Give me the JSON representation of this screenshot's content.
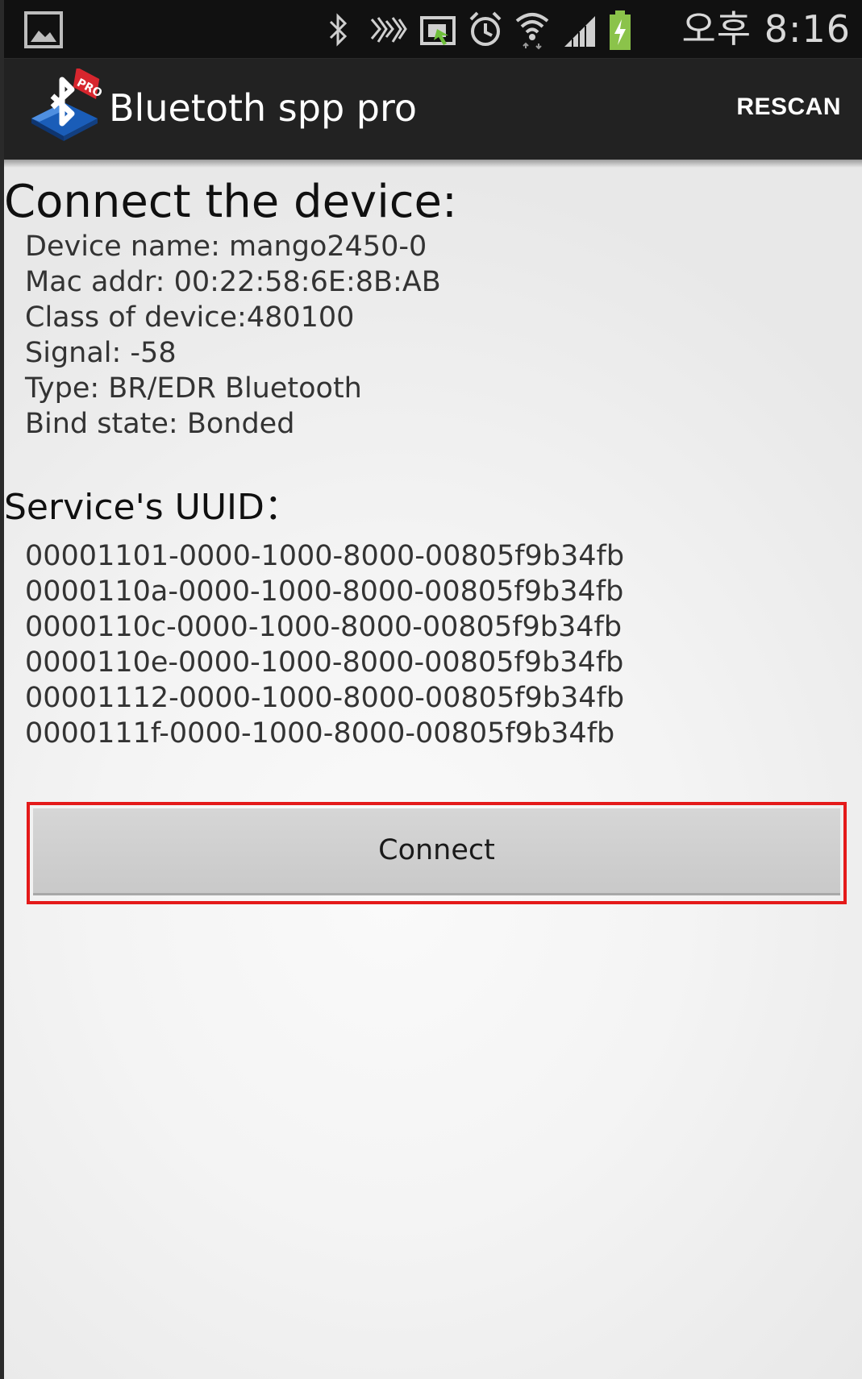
{
  "status_bar": {
    "time": "오후 8:16",
    "icons": [
      "gallery-icon",
      "bluetooth-icon",
      "nfc-icon",
      "screen-mirror-icon",
      "alarm-icon",
      "wifi-icon",
      "signal-icon",
      "battery-charging-icon"
    ]
  },
  "action_bar": {
    "app_title": "Bluetoth spp pro",
    "logo_badge": "PRO",
    "rescan_label": "RESCAN"
  },
  "device": {
    "heading": "Connect the device:",
    "lines": [
      "Device name: mango2450-0",
      "Mac addr: 00:22:58:6E:8B:AB",
      "Class of device:480100",
      "Signal: -58",
      "Type: BR/EDR Bluetooth",
      "Bind state: Bonded"
    ]
  },
  "services": {
    "heading": "Service's UUID：",
    "uuids": [
      "00001101-0000-1000-8000-00805f9b34fb",
      "0000110a-0000-1000-8000-00805f9b34fb",
      "0000110c-0000-1000-8000-00805f9b34fb",
      "0000110e-0000-1000-8000-00805f9b34fb",
      "00001112-0000-1000-8000-00805f9b34fb",
      "0000111f-0000-1000-8000-00805f9b34fb"
    ]
  },
  "connect_button": {
    "label": "Connect",
    "highlight_color": "#e41a1a"
  },
  "colors": {
    "status_bar_bg": "#111111",
    "action_bar_bg": "#222222",
    "battery_green": "#8bc34a"
  }
}
